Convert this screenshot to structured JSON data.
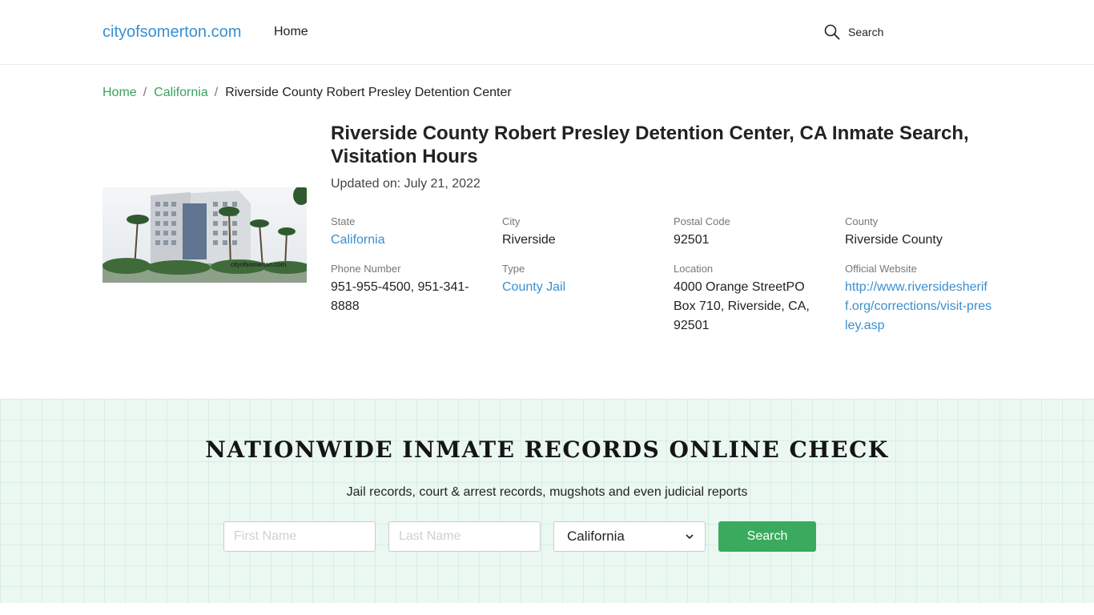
{
  "header": {
    "logo": "cityofsomerton.com",
    "nav_home": "Home",
    "search_label": "Search"
  },
  "breadcrumb": {
    "home": "Home",
    "state": "California",
    "current": "Riverside County Robert Presley Detention Center"
  },
  "hero_image": {
    "watermark": "cityofsomerton.com"
  },
  "page": {
    "title": "Riverside County Robert Presley Detention Center, CA Inmate Search, Visitation Hours",
    "updated": "Updated on: July 21, 2022"
  },
  "info": {
    "state_label": "State",
    "state_value": "California",
    "city_label": "City",
    "city_value": "Riverside",
    "postal_label": "Postal Code",
    "postal_value": "92501",
    "county_label": "County",
    "county_value": "Riverside County",
    "phone_label": "Phone Number",
    "phone_value": "951-955-4500, 951-341-8888",
    "type_label": "Type",
    "type_value": "County Jail",
    "location_label": "Location",
    "location_value": "4000 Orange StreetPO Box 710, Riverside, CA, 92501",
    "website_label": "Official Website",
    "website_value": "http://www.riversidesheriff.org/corrections/visit-presley.asp"
  },
  "search_band": {
    "title": "NATIONWIDE INMATE RECORDS ONLINE CHECK",
    "subtitle": "Jail records, court & arrest records, mugshots and even judicial reports",
    "first_name_placeholder": "First Name",
    "last_name_placeholder": "Last Name",
    "state_selected": "California",
    "submit_label": "Search"
  },
  "colors": {
    "link_blue": "#3a8fd0",
    "breadcrumb_green": "#3aa25f",
    "button_green": "#3aab5e",
    "band_background": "#ebf8f1"
  },
  "icons": {
    "header_search": "search-icon",
    "select_arrow": "chevron-down-icon"
  }
}
